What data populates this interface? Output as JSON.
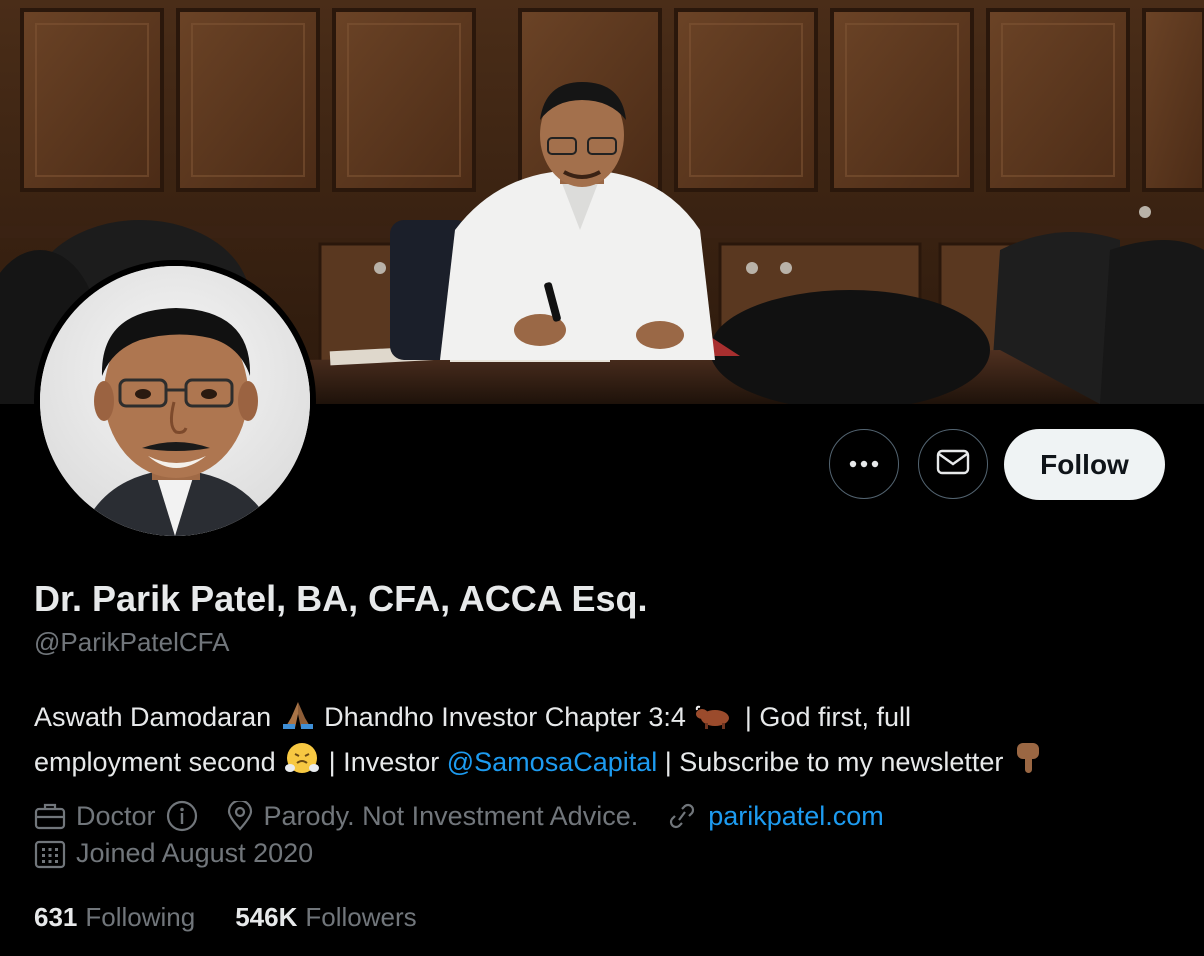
{
  "profile": {
    "display_name": "Dr. Parik Patel, BA, CFA, ACCA Esq.",
    "handle": "@ParikPatelCFA"
  },
  "bio": {
    "line1_a": "Aswath Damodaran",
    "line1_b": "Dhandho Investor Chapter 3:4",
    "line1_c": "| God first, full",
    "line2_a": "employment second",
    "line2_b": "| Investor",
    "line2_mention": "@SamosaCapital",
    "line2_c": "| Subscribe to my newsletter"
  },
  "meta": {
    "profession": "Doctor",
    "location": "Parody. Not Investment Advice.",
    "website": "parikpatel.com",
    "joined": "Joined August 2020"
  },
  "stats": {
    "following_count": "631",
    "following_label": "Following",
    "followers_count": "546K",
    "followers_label": "Followers"
  },
  "actions": {
    "follow_label": "Follow"
  },
  "icons": {
    "more": "more-horizontal-icon",
    "message": "envelope-icon",
    "profession": "briefcase-icon",
    "info": "info-icon",
    "location": "location-pin-icon",
    "website": "link-icon",
    "joined": "calendar-icon",
    "emoji_1": "folded-hands-emoji",
    "emoji_2": "ox-emoji",
    "emoji_3": "steam-face-emoji",
    "emoji_4": "pointing-down-emoji"
  },
  "colors": {
    "background": "#000000",
    "text": "#e7e9ea",
    "muted": "#71767b",
    "link": "#1d9bf0",
    "follow_button": "#eff3f4"
  }
}
